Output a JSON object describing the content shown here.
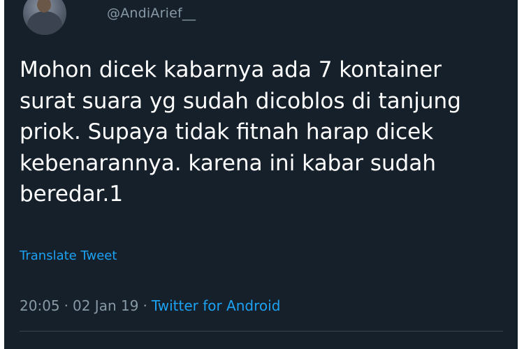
{
  "tweet": {
    "handle": "@AndiArief__",
    "text_lines": [
      "Mohon dicek kabarnya ada 7 kontainer",
      "surat suara yg sudah dicoblos di tanjung",
      "priok. Supaya tidak fitnah harap dicek",
      "kebenarannya. karena ini kabar sudah",
      "beredar.1"
    ],
    "translate_label": "Translate Tweet",
    "time": "20:05",
    "separator": "·",
    "date": "02 Jan 19",
    "source": "Twitter for Android"
  },
  "colors": {
    "background": "#15202b",
    "text": "#ffffff",
    "secondary_text": "#8899a6",
    "link": "#1da1f2",
    "divider": "#38444d"
  }
}
